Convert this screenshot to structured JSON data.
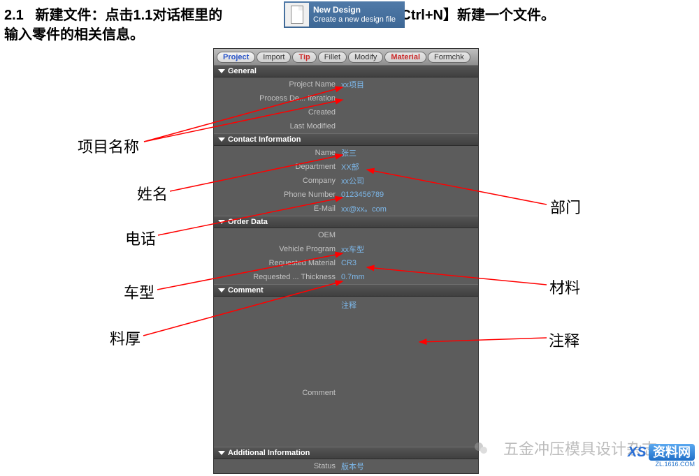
{
  "header": {
    "section_num": "2.1",
    "text_line1_a": "新建文件：点击1.1对话框里的",
    "text_line1_b": "or【Ctrl+N】新建一个文件。",
    "text_line2": "输入零件的相关信息。"
  },
  "new_design_button": {
    "title": "New Design",
    "subtitle": "Create a new design file"
  },
  "tabs": [
    {
      "label": "Project",
      "class": "active"
    },
    {
      "label": "Import",
      "class": ""
    },
    {
      "label": "Tip",
      "class": "red"
    },
    {
      "label": "Fillet",
      "class": ""
    },
    {
      "label": "Modify",
      "class": ""
    },
    {
      "label": "Material",
      "class": "red"
    },
    {
      "label": "Formchk",
      "class": ""
    }
  ],
  "sections": {
    "general": {
      "title": "General",
      "rows": [
        {
          "label": "Project Name",
          "value": "xx项目"
        },
        {
          "label": "Process De... Iteration",
          "value": ""
        },
        {
          "label": "Created",
          "value": ""
        },
        {
          "label": "Last Modified",
          "value": ""
        }
      ]
    },
    "contact": {
      "title": "Contact Information",
      "rows": [
        {
          "label": "Name",
          "value": "张三"
        },
        {
          "label": "Department",
          "value": "XX部"
        },
        {
          "label": "Company",
          "value": "xx公司"
        },
        {
          "label": "Phone Number",
          "value": "0123456789"
        },
        {
          "label": "E-Mail",
          "value": "xx@xx。com"
        }
      ]
    },
    "order": {
      "title": "Order Data",
      "rows": [
        {
          "label": "OEM",
          "value": ""
        },
        {
          "label": "Vehicle Program",
          "value": "xx车型"
        },
        {
          "label": "Requested Material",
          "value": "CR3"
        },
        {
          "label": "Requested ... Thickness",
          "value": "0.7mm"
        }
      ]
    },
    "comment": {
      "title": "Comment",
      "commentLabel": "Comment",
      "value": "注释"
    },
    "additional": {
      "title": "Additional Information",
      "rows": [
        {
          "label": "Status",
          "value": "版本号"
        }
      ]
    }
  },
  "annotations": {
    "project_name": "项目名称",
    "name": "姓名",
    "phone": "电话",
    "vehicle": "车型",
    "thickness": "料厚",
    "department": "部门",
    "material": "材料",
    "comment": "注释"
  },
  "watermark": {
    "text": "五金冲压模具设计杂志",
    "brand": "资料网",
    "prefix": "XS",
    "url": "ZL.1616.COM"
  }
}
